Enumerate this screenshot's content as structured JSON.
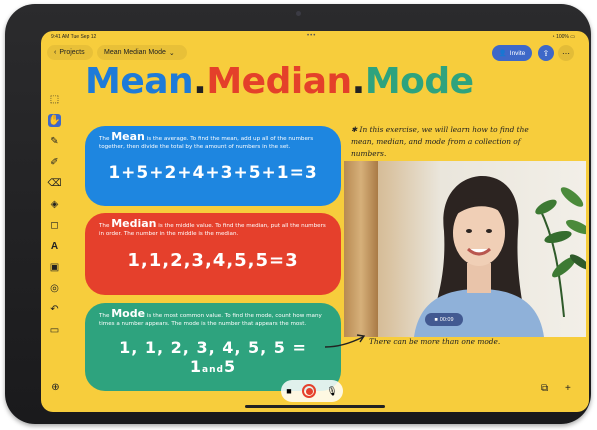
{
  "status": {
    "time": "9:41 AM  Tue Sep 12",
    "battery": "100%",
    "dots": "•••"
  },
  "topbar": {
    "back_label": "Projects",
    "doc_title": "Mean Median Mode",
    "invite_label": "Invite"
  },
  "title": {
    "mean": "Mean",
    "median": "Median",
    "mode": "Mode",
    "dot": "."
  },
  "cards": {
    "mean": {
      "keyword": "Mean",
      "text_before": "The ",
      "text_after": " is the average. To find the mean, add up all of the numbers together, then divide the total by the amount of numbers in the set.",
      "equation": "1+5+2+4+3+5+1=3"
    },
    "median": {
      "keyword": "Median",
      "text_before": "The ",
      "text_after": " is the middle value. To find the median, put all the numbers in order. The number in the middle is the median.",
      "equation": "1,1,2,3,4,5,5=3"
    },
    "mode": {
      "keyword": "Mode",
      "text_before": "The ",
      "text_after": " is the most common value. To find the mode, count how many times a number appears. The mode is the number that appears the most.",
      "equation_main": "1, 1, 2, 3, 4, 5, 5 = 1",
      "equation_and": "and",
      "equation_end": "5"
    }
  },
  "notes": {
    "intro": "In this exercise, we will learn how to find the mean, median, and mode from a collection of numbers.",
    "footnote": "There can be more than one mode."
  },
  "video": {
    "timer": "00:09"
  },
  "colors": {
    "background": "#f7cd3c",
    "blue": "#1e86e0",
    "red": "#e5402c",
    "green": "#2ea37e",
    "accent": "#3e68c8"
  },
  "icons": {
    "toolbar": [
      "select-icon",
      "hand-icon",
      "pen-icon",
      "marker-icon",
      "eraser-icon",
      "fill-icon",
      "shapes-icon",
      "text-icon",
      "sticky-icon",
      "lasso-icon",
      "undo-icon",
      "layout-icon"
    ]
  }
}
